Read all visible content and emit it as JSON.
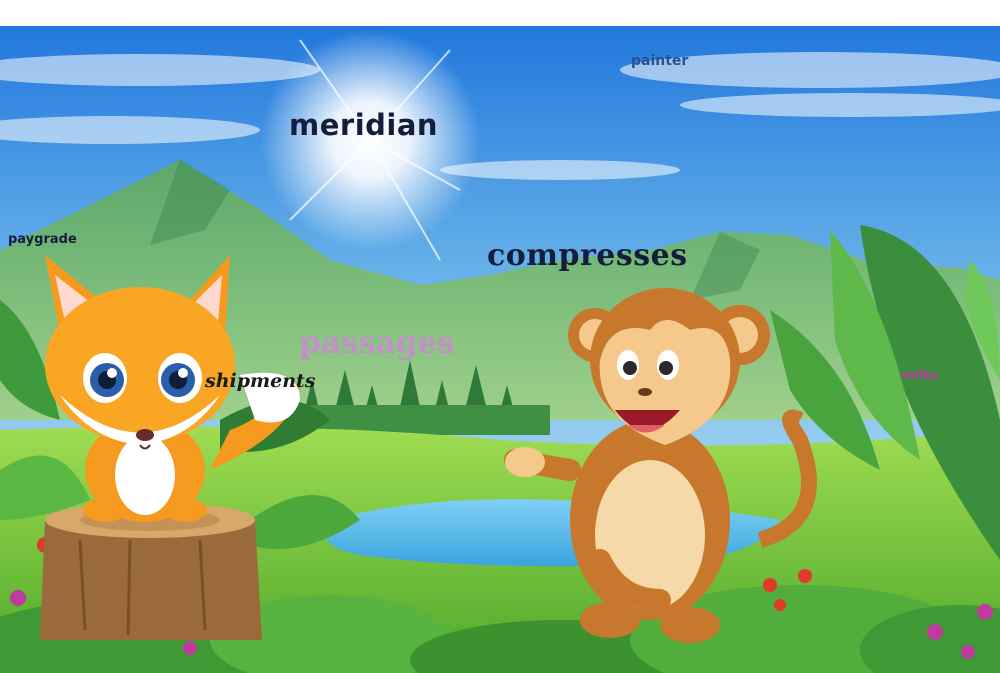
{
  "scene": {
    "description_words": [
      "painter",
      "meridian",
      "paygrade",
      "compresses",
      "passages",
      "shipments",
      "milks"
    ]
  },
  "labels": {
    "painter": "painter",
    "meridian": "meridian",
    "paygrade": "paygrade",
    "compresses": "compresses",
    "passages": "passages",
    "shipments": "shipments",
    "milks": "milks"
  },
  "colors": {
    "sky_top": "#1d7fe0",
    "sky_bottom": "#bfe4f5",
    "mountain": "#4a9a58",
    "grass": "#6cc23a",
    "lake": "#5ab8ea",
    "fox": "#f59a1e",
    "monkey": "#c8782c"
  }
}
